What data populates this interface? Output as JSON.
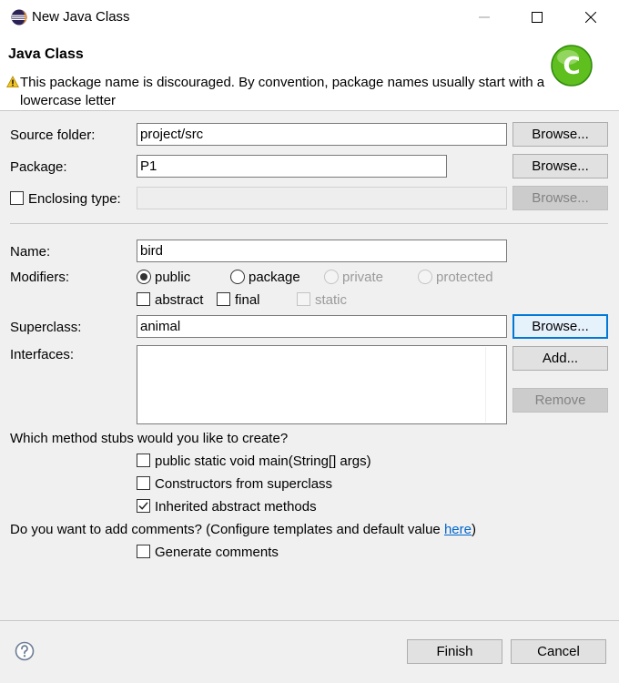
{
  "window": {
    "title": "New Java Class",
    "controls": [
      "minimize-icon",
      "maximize-icon",
      "close-icon"
    ]
  },
  "banner": {
    "title": "Java Class",
    "message": "This package name is discouraged. By convention, package names usually start with a lowercase letter",
    "badge_letter": "C",
    "icons": [
      "warning-icon",
      "class-badge-icon"
    ]
  },
  "source_folder": {
    "label": "Source folder:",
    "value": "project/src",
    "button": "Browse..."
  },
  "package": {
    "label": "Package:",
    "value": "P1",
    "button": "Browse..."
  },
  "enclosing": {
    "label": "Enclosing type:",
    "checked": false,
    "value": "",
    "button": "Browse..."
  },
  "name": {
    "label": "Name:",
    "value": "bird"
  },
  "modifiers": {
    "label": "Modifiers:",
    "access": [
      {
        "label": "public",
        "selected": true,
        "enabled": true
      },
      {
        "label": "package",
        "selected": false,
        "enabled": true
      },
      {
        "label": "private",
        "selected": false,
        "enabled": false
      },
      {
        "label": "protected",
        "selected": false,
        "enabled": false
      }
    ],
    "flags": [
      {
        "label": "abstract",
        "checked": false,
        "enabled": true
      },
      {
        "label": "final",
        "checked": false,
        "enabled": true
      },
      {
        "label": "static",
        "checked": false,
        "enabled": false
      }
    ]
  },
  "superclass": {
    "label": "Superclass:",
    "value": "animal",
    "button": "Browse..."
  },
  "interfaces": {
    "label": "Interfaces:",
    "add_button": "Add...",
    "remove_button": "Remove"
  },
  "stubs": {
    "question": "Which method stubs would you like to create?",
    "options": [
      {
        "label": "public static void main(String[] args)",
        "checked": false
      },
      {
        "label": "Constructors from superclass",
        "checked": false
      },
      {
        "label": "Inherited abstract methods",
        "checked": true
      }
    ]
  },
  "comments": {
    "question": "Do you want to add comments? (Configure templates and default value ",
    "link": "here",
    "close_paren": ")",
    "option": {
      "label": "Generate comments",
      "checked": false
    }
  },
  "footer": {
    "help_icon": "help-icon",
    "finish": "Finish",
    "cancel": "Cancel"
  },
  "colors": {
    "accent": "#0078d7",
    "link": "#0066cc",
    "badge": "#5fbf1f"
  }
}
